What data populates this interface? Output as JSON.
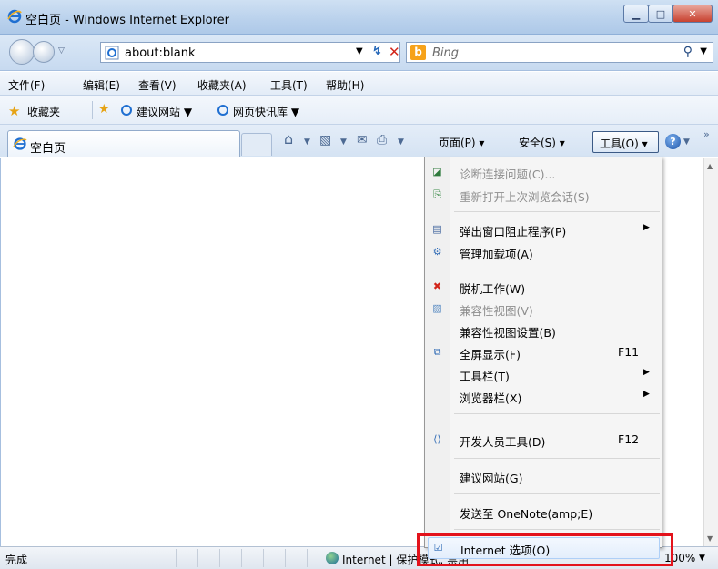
{
  "window": {
    "title": "空白页 - Windows Internet Explorer"
  },
  "address": {
    "url": "about:blank",
    "search_placeholder": "Bing"
  },
  "menubar": {
    "items": [
      "文件(F)",
      "编辑(E)",
      "查看(V)",
      "收藏夹(A)",
      "工具(T)",
      "帮助(H)"
    ]
  },
  "favorites": {
    "label": "收藏夹",
    "links": [
      "建议网站 ▼",
      "网页快讯库 ▼"
    ]
  },
  "tab": {
    "label": "空白页"
  },
  "command_bar": {
    "page": "页面(P) ▾",
    "safety": "安全(S) ▾",
    "tools": "工具(O) ▾"
  },
  "status": {
    "left": "完成",
    "zone": "Internet | 保护模式: 禁用",
    "zoom": "100%"
  },
  "tools_menu": {
    "items": [
      {
        "label": "诊断连接问题(C)...",
        "disabled": true,
        "icon": "diagnose-icon"
      },
      {
        "label": "重新打开上次浏览会话(S)",
        "disabled": true,
        "icon": "reopen-session-icon"
      },
      {
        "label": "弹出窗口阻止程序(P)",
        "icon": "popup-blocker-icon",
        "submenu": true
      },
      {
        "label": "管理加载项(A)",
        "icon": "addons-icon"
      },
      {
        "label": "脱机工作(W)",
        "icon": "offline-icon"
      },
      {
        "label": "兼容性视图(V)",
        "disabled": true,
        "icon": "compat-view-icon"
      },
      {
        "label": "兼容性视图设置(B)"
      },
      {
        "label": "全屏显示(F)",
        "shortcut": "F11",
        "icon": "fullscreen-icon"
      },
      {
        "label": "工具栏(T)",
        "submenu": true
      },
      {
        "label": "浏览器栏(X)",
        "submenu": true
      },
      {
        "label": "开发人员工具(D)",
        "shortcut": "F12",
        "icon": "devtools-icon"
      },
      {
        "label": "建议网站(G)"
      },
      {
        "label": "发送至 OneNote(amp;E)"
      },
      {
        "label": "Internet 选项(O)",
        "icon": "internet-options-icon"
      }
    ]
  },
  "colors": {
    "highlight_box": "#e3121b",
    "accent": "#1d54a8"
  }
}
